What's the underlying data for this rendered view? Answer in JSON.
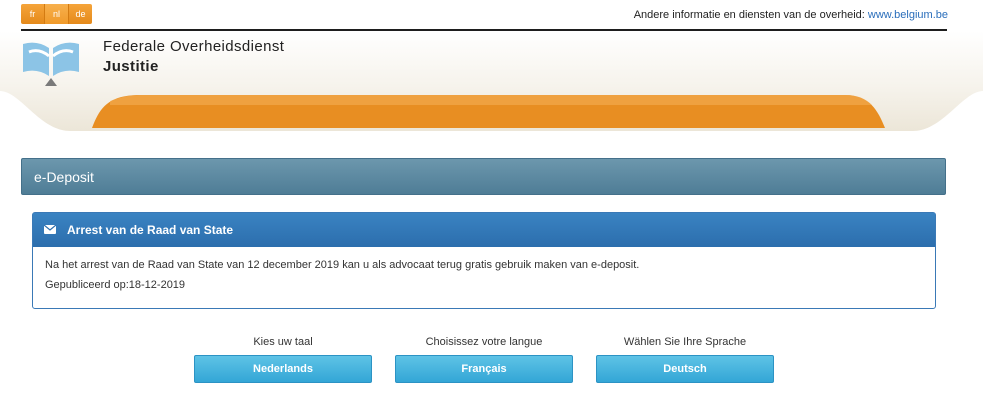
{
  "topbar": {
    "languages": [
      "fr",
      "nl",
      "de"
    ],
    "active_language": "nl",
    "gov_info_text": "Andere informatie en diensten van de overheid:",
    "gov_link_text": "www.belgium.be"
  },
  "header": {
    "org_line1": "Federale Overheidsdienst",
    "org_line2": "Justitie"
  },
  "panel": {
    "title": "e-Deposit"
  },
  "news": {
    "title": "Arrest van de Raad van State",
    "text": "Na het arrest van de Raad van State van 12 december 2019 kan u als advocaat terug gratis gebruik maken van e-deposit.",
    "published": "Gepubliceerd op:18-12-2019"
  },
  "language_choices": [
    {
      "label": "Kies uw taal",
      "button": "Nederlands"
    },
    {
      "label": "Choisissez votre langue",
      "button": "Français"
    },
    {
      "label": "Wählen Sie Ihre Sprache",
      "button": "Deutsch"
    }
  ],
  "colors": {
    "orange": "#e88e22",
    "panel_blue_gray": "#5a879f",
    "card_blue": "#2f74b3",
    "button_cyan": "#45b3de"
  }
}
